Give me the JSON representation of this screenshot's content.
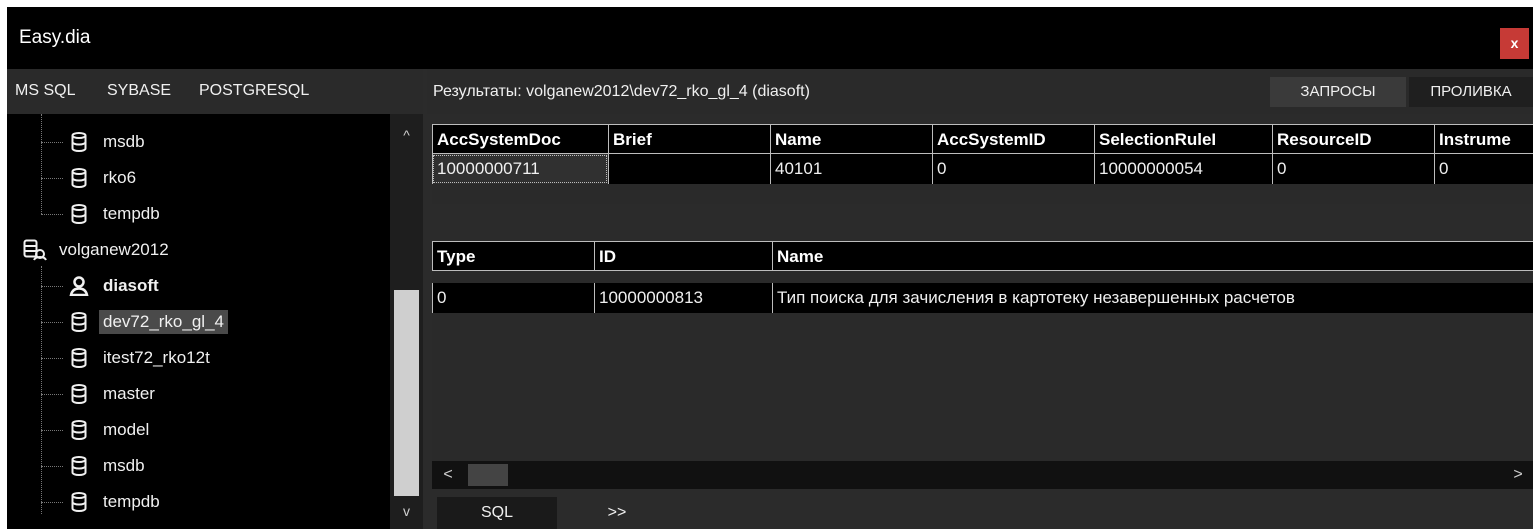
{
  "window": {
    "title": "Easy.dia",
    "close_label": "x"
  },
  "server_tabs": [
    "MS SQL",
    "SYBASE",
    "POSTGRESQL"
  ],
  "tree": {
    "items": [
      {
        "label": "msdb",
        "icon": "database-icon",
        "level": 2
      },
      {
        "label": "rko6",
        "icon": "database-icon",
        "level": 2
      },
      {
        "label": "tempdb",
        "icon": "database-icon",
        "level": 2
      },
      {
        "label": "volganew2012",
        "icon": "server-icon",
        "level": 1
      },
      {
        "label": "diasoft",
        "icon": "user-icon",
        "level": 2,
        "bold": true
      },
      {
        "label": "dev72_rko_gl_4",
        "icon": "database-icon",
        "level": 2,
        "selected": true
      },
      {
        "label": "itest72_rko12t",
        "icon": "database-icon",
        "level": 2
      },
      {
        "label": "master",
        "icon": "database-icon",
        "level": 2
      },
      {
        "label": "model",
        "icon": "database-icon",
        "level": 2
      },
      {
        "label": "msdb",
        "icon": "database-icon",
        "level": 2
      },
      {
        "label": "tempdb",
        "icon": "database-icon",
        "level": 2
      }
    ],
    "scroll_up": "^",
    "scroll_down": "v"
  },
  "results": {
    "title": "Результаты: volganew2012\\dev72_rko_gl_4 (diasoft)",
    "queries_label": "ЗАПРОСЫ",
    "flush_label": "ПРОЛИВКА"
  },
  "grid1": {
    "columns": [
      "AccSystemDoc",
      "Brief",
      "Name",
      "AccSystemID",
      "SelectionRuleI",
      "ResourceID",
      "Instrume"
    ],
    "rows": [
      [
        "10000000711",
        "",
        "40101",
        "0",
        "10000000054",
        "0",
        "0"
      ]
    ]
  },
  "grid2": {
    "columns": [
      "Type",
      "ID",
      "Name"
    ],
    "rows": [
      [
        "0",
        "10000000813",
        "Тип поиска для зачисления в картотеку незавершенных расчетов"
      ]
    ]
  },
  "hscroll": {
    "left_arrow": "<",
    "right_arrow": ">"
  },
  "bottom_tabs": [
    "SQL",
    ">>"
  ],
  "colors": {
    "background": "#2b2b2b",
    "titlebar": "#000000",
    "close": "#c63a36",
    "grid": "#000000",
    "selection": "#4a4a4a"
  }
}
